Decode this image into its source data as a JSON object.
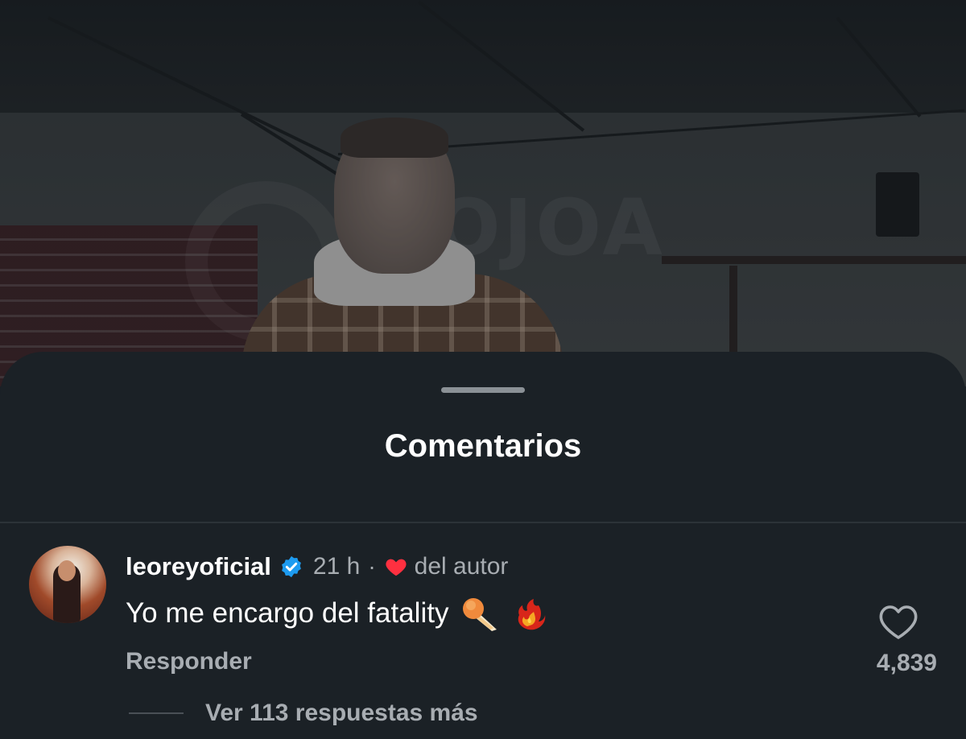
{
  "video": {
    "watermark_text": "OJOA"
  },
  "sheet": {
    "title": "Comentarios"
  },
  "comment": {
    "username": "leoreyoficial",
    "verified_icon": "verified-badge-icon",
    "time": "21 h",
    "separator": "·",
    "author_like_icon": "red-heart-icon",
    "author_like_label": "del autor",
    "text": "Yo me encargo del fatality",
    "emojis": [
      "comet-emoji",
      "phoenix-fire-emoji"
    ],
    "reply_label": "Responder",
    "like_icon": "heart-outline-icon",
    "like_count": "4,839",
    "view_replies_label": "Ver 113 respuestas más"
  },
  "colors": {
    "sheet_bg": "#1b2126",
    "text_primary": "#ffffff",
    "text_secondary": "#a8adb2",
    "verified_blue": "#1d9bf0",
    "heart_red": "#ff3040"
  }
}
